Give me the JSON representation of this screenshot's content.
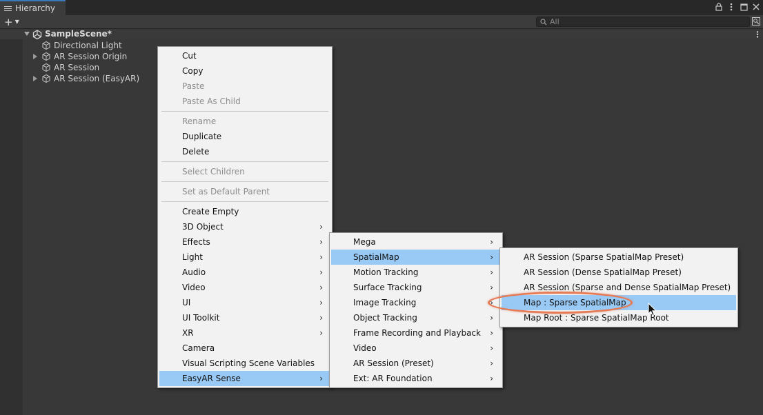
{
  "window": {
    "tab_title": "Hierarchy",
    "tab_icon": "list-icon",
    "controls": [
      "lock-icon",
      "more-icon",
      "maximize-icon",
      "close-icon"
    ]
  },
  "toolbar": {
    "add_label": "+",
    "search_placeholder": "All"
  },
  "hierarchy": {
    "scene_name": "SampleScene*",
    "items": [
      {
        "label": "Directional Light",
        "expandable": false
      },
      {
        "label": "AR Session Origin",
        "expandable": true
      },
      {
        "label": "AR Session",
        "expandable": false
      },
      {
        "label": "AR Session (EasyAR)",
        "expandable": true
      }
    ]
  },
  "context_menu": {
    "groups": [
      [
        {
          "label": "Cut"
        },
        {
          "label": "Copy"
        },
        {
          "label": "Paste",
          "disabled": true
        },
        {
          "label": "Paste As Child",
          "disabled": true
        }
      ],
      [
        {
          "label": "Rename",
          "disabled": true
        },
        {
          "label": "Duplicate"
        },
        {
          "label": "Delete"
        }
      ],
      [
        {
          "label": "Select Children",
          "disabled": true
        }
      ],
      [
        {
          "label": "Set as Default Parent",
          "disabled": true
        }
      ],
      [
        {
          "label": "Create Empty"
        },
        {
          "label": "3D Object",
          "submenu": true
        },
        {
          "label": "Effects",
          "submenu": true
        },
        {
          "label": "Light",
          "submenu": true
        },
        {
          "label": "Audio",
          "submenu": true
        },
        {
          "label": "Video",
          "submenu": true
        },
        {
          "label": "UI",
          "submenu": true
        },
        {
          "label": "UI Toolkit",
          "submenu": true
        },
        {
          "label": "XR",
          "submenu": true
        },
        {
          "label": "Camera"
        },
        {
          "label": "Visual Scripting Scene Variables"
        },
        {
          "label": "EasyAR Sense",
          "submenu": true,
          "highlighted": true
        }
      ]
    ]
  },
  "easyar_submenu": [
    {
      "label": "Mega",
      "submenu": true
    },
    {
      "label": "SpatialMap",
      "submenu": true,
      "highlighted": true
    },
    {
      "label": "Motion Tracking",
      "submenu": true
    },
    {
      "label": "Surface Tracking",
      "submenu": true
    },
    {
      "label": "Image Tracking",
      "submenu": true
    },
    {
      "label": "Object Tracking",
      "submenu": true
    },
    {
      "label": "Frame Recording and Playback",
      "submenu": true
    },
    {
      "label": "Video",
      "submenu": true
    },
    {
      "label": "AR Session (Preset)",
      "submenu": true
    },
    {
      "label": "Ext: AR Foundation",
      "submenu": true
    }
  ],
  "spatialmap_submenu": [
    {
      "label": "AR Session (Sparse SpatialMap Preset)"
    },
    {
      "label": "AR Session (Dense SpatialMap Preset)"
    },
    {
      "label": "AR Session (Sparse and Dense SpatialMap Preset)"
    },
    {
      "label": "Map : Sparse SpatialMap",
      "highlighted": true
    },
    {
      "label": "Map Root : Sparse SpatialMap Root"
    }
  ],
  "colors": {
    "menu_highlight": "#99c9f5",
    "annotation_ring": "#e57a55",
    "tab_accent": "#3a79bb"
  }
}
